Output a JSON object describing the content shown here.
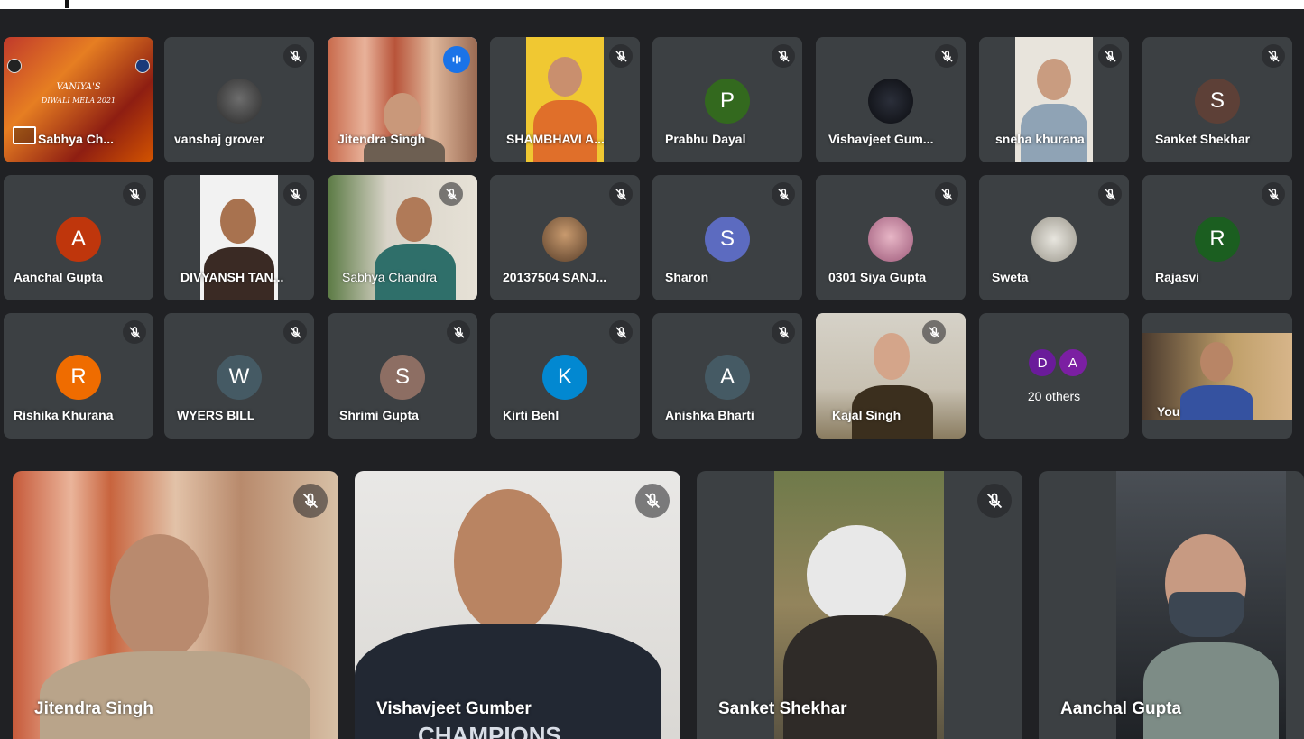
{
  "grid": [
    {
      "name": "Sabhya Ch...",
      "type": "presentation",
      "slide_line1": "VANIYA'S",
      "slide_line2": "DIWALI MELA 2021"
    },
    {
      "name": "vanshaj grover",
      "type": "photo",
      "muted": true
    },
    {
      "name": "Jitendra Singh",
      "type": "video",
      "speaking": true
    },
    {
      "name": "SHAMBHAVI A...",
      "type": "video",
      "muted": true
    },
    {
      "name": "Prabhu Dayal",
      "type": "initial",
      "initial": "P",
      "color": "#33691e",
      "muted": true
    },
    {
      "name": "Vishavjeet Gum...",
      "type": "photo",
      "muted": true
    },
    {
      "name": "sneha khurana",
      "type": "video",
      "muted": true
    },
    {
      "name": "Sanket Shekhar",
      "type": "initial",
      "initial": "S",
      "color": "#5d4037",
      "muted": true
    },
    {
      "name": "Aanchal Gupta",
      "type": "initial",
      "initial": "A",
      "color": "#bf360c",
      "muted": true
    },
    {
      "name": "DIVYANSH TAN...",
      "type": "video",
      "muted": true
    },
    {
      "name": "Sabhya Chandra",
      "type": "video",
      "muted": true
    },
    {
      "name": "20137504 SANJ...",
      "type": "photo",
      "muted": true
    },
    {
      "name": "Sharon",
      "type": "initial",
      "initial": "S",
      "color": "#5c6bc0",
      "muted": true
    },
    {
      "name": "0301 Siya Gupta",
      "type": "photo",
      "muted": true
    },
    {
      "name": "Sweta",
      "type": "photo",
      "muted": true
    },
    {
      "name": "Rajasvi",
      "type": "initial",
      "initial": "R",
      "color": "#1b5e20",
      "muted": true
    },
    {
      "name": "Rishika Khurana",
      "type": "initial",
      "initial": "R",
      "color": "#ef6c00",
      "muted": true
    },
    {
      "name": "WYERS BILL",
      "type": "initial",
      "initial": "W",
      "color": "#455a64",
      "muted": true
    },
    {
      "name": "Shrimi Gupta",
      "type": "initial",
      "initial": "S",
      "color": "#8d6e63",
      "muted": true
    },
    {
      "name": "Kirti Behl",
      "type": "initial",
      "initial": "K",
      "color": "#0288d1",
      "muted": true
    },
    {
      "name": "Anishka Bharti",
      "type": "initial",
      "initial": "A",
      "color": "#455a64",
      "muted": true
    },
    {
      "name": "Kajal Singh",
      "type": "video",
      "muted": true
    },
    {
      "name": "others",
      "type": "others"
    },
    {
      "name": "You",
      "type": "video"
    }
  ],
  "others": {
    "label": "20 others",
    "avatars": [
      {
        "initial": "D",
        "color": "#6a1b9a"
      },
      {
        "initial": "A",
        "color": "#7b1fa2"
      }
    ]
  },
  "featured": [
    {
      "name": "Jitendra Singh",
      "muted": true
    },
    {
      "name": "Vishavjeet Gumber",
      "muted": true,
      "shirt_text": "CHAMPIONS"
    },
    {
      "name": "Sanket Shekhar",
      "muted": true
    },
    {
      "name": "Aanchal Gupta",
      "muted": false
    }
  ],
  "icons": {
    "mute": "mic-off-icon",
    "speaking": "audio-level-icon",
    "present": "presentation-icon"
  }
}
